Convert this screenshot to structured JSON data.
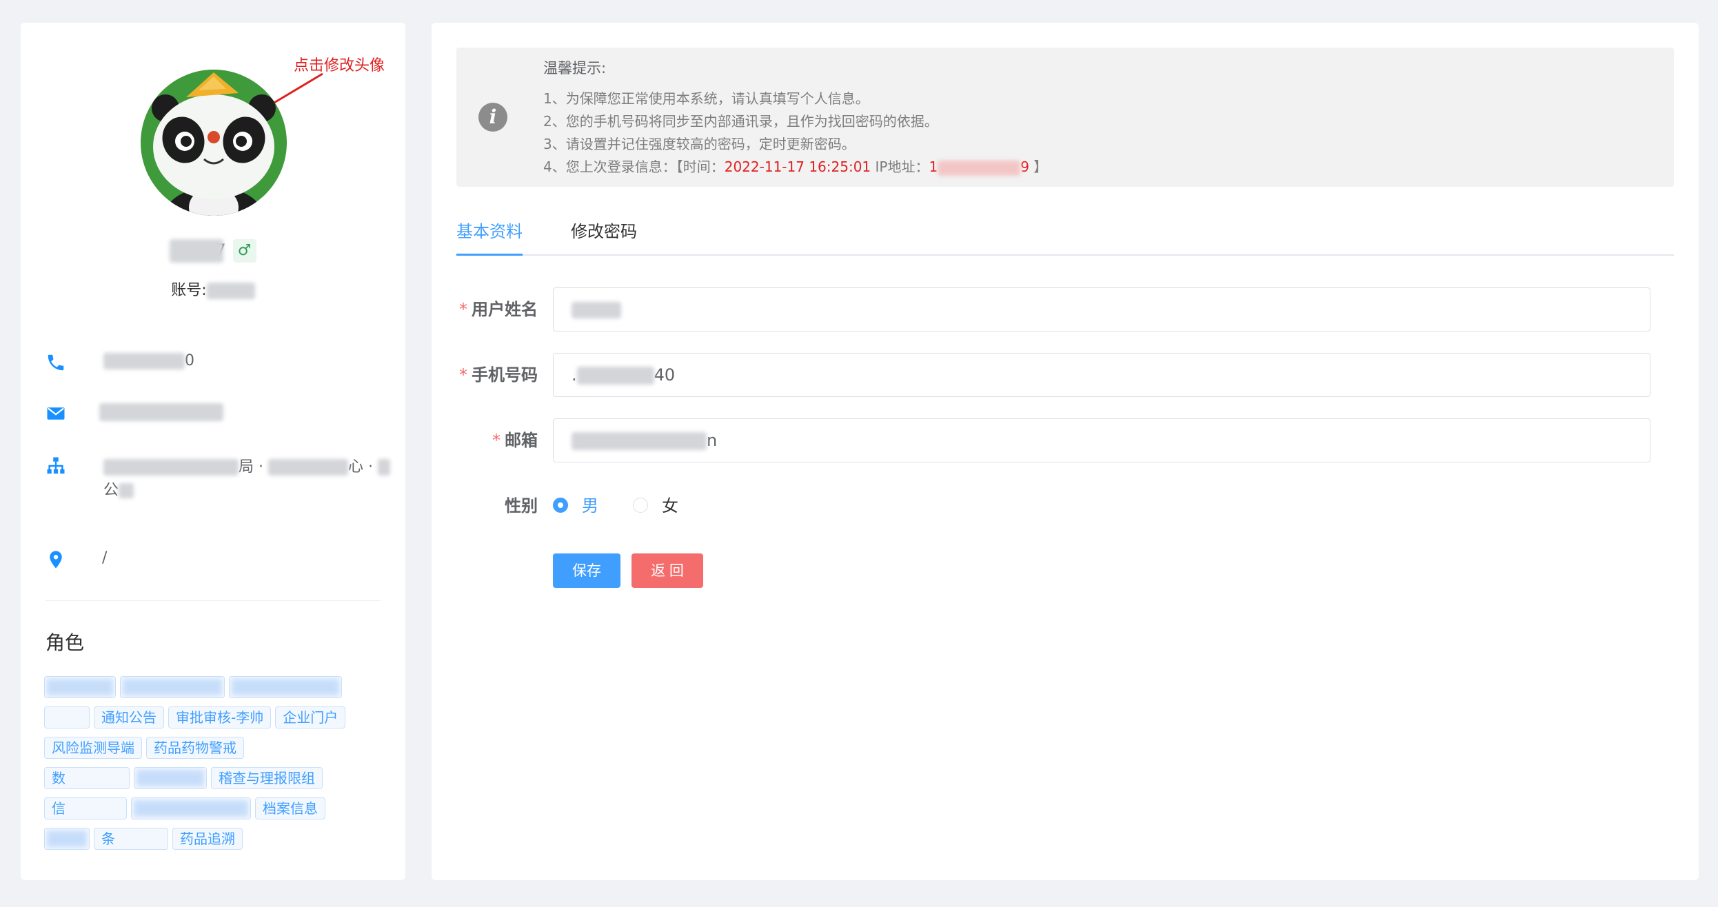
{
  "annotation": {
    "avatar_hint": "点击修改头像"
  },
  "profile": {
    "name_suffix": "7",
    "gender_symbol": "♂",
    "account_label": "账号:",
    "phone_suffix": "0",
    "dept_part1": "局 ·",
    "dept_part2": "心 ·",
    "dept_part3": "公",
    "location": "/"
  },
  "roles": {
    "title": "角色",
    "tags": [
      "",
      "",
      "",
      "",
      "通知公告",
      "审批审核-李帅",
      "企业门户",
      "风险监测导端",
      "药品药物警戒",
      "数",
      "",
      "稽查与理报限组",
      "信",
      "",
      "档案信息",
      "",
      "条",
      "药品追溯"
    ]
  },
  "notice": {
    "title": "温馨提示:",
    "line1": "1、为保障您正常使用本系统，请认真填写个人信息。",
    "line2": "2、您的手机号码将同步至内部通讯录，且作为找回密码的依据。",
    "line3": "3、请设置并记住强度较高的密码，定时更新密码。",
    "line4_prefix": "4、您上次登录信息：【时间：",
    "login_time": "2022-11-17 16:25:01",
    "ip_label": " IP地址：",
    "ip_prefix": "1",
    "ip_suffix": "9",
    "line4_suffix": " 】"
  },
  "tabs": {
    "basic": "基本资料",
    "password": "修改密码"
  },
  "form": {
    "name_label": "用户姓名",
    "phone_label": "手机号码",
    "phone_value_prefix": ".",
    "phone_value_suffix": "40",
    "email_label": "邮箱",
    "email_value_prefix": "",
    "email_value_suffix": "n",
    "gender_label": "性别",
    "gender_options": [
      "男",
      "女"
    ],
    "gender_selected": "男",
    "required_mark": "*"
  },
  "buttons": {
    "save": "保存",
    "back": "返 回"
  },
  "colors": {
    "primary": "#409eff",
    "danger": "#f56c6c",
    "annotation": "#e02020"
  }
}
